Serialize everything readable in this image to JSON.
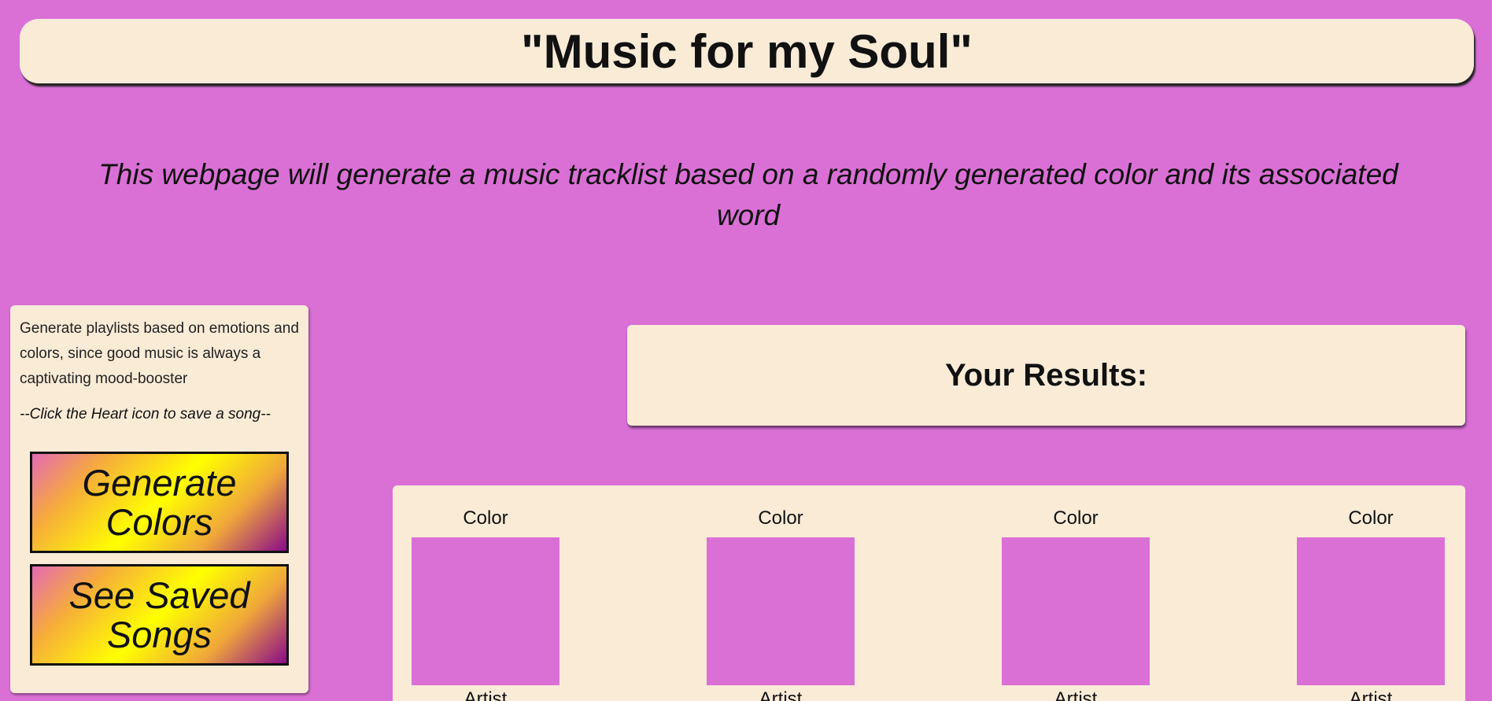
{
  "header": {
    "title": "\"Music for my Soul\""
  },
  "subtitle": "This webpage will generate a music tracklist based on a randomly generated color and its associated word",
  "sidebar": {
    "description": "Generate playlists based on emotions and colors, since good music is always a captivating mood-booster",
    "hint": "--Click the Heart icon to save a song--",
    "generate_button": "Generate Colors",
    "saved_button": "See Saved Songs"
  },
  "results": {
    "title": "Your Results:",
    "cards": [
      {
        "label": "Color",
        "artist": "Artist"
      },
      {
        "label": "Color",
        "artist": "Artist"
      },
      {
        "label": "Color",
        "artist": "Artist"
      },
      {
        "label": "Color",
        "artist": "Artist"
      }
    ]
  },
  "colors": {
    "background": "#da70d6",
    "panel": "#faebd7",
    "swatch": "#da70d6"
  }
}
